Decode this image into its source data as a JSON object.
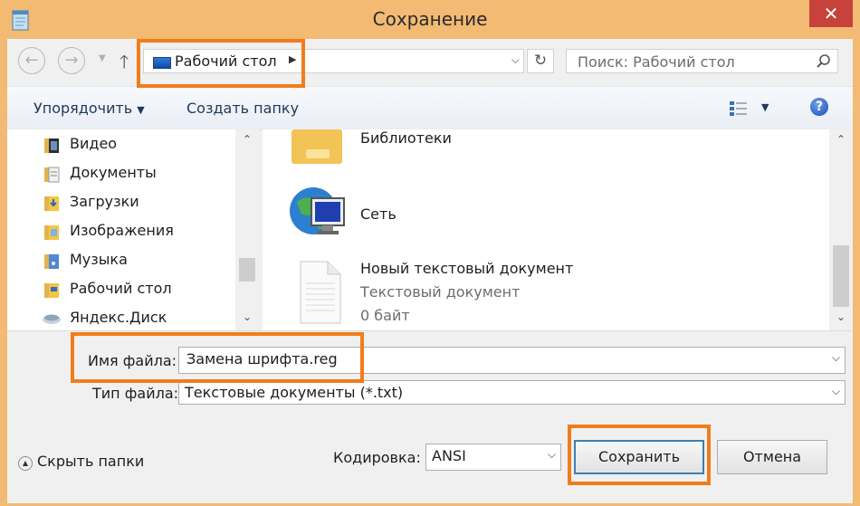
{
  "window": {
    "title": "Сохранение",
    "close_label": "✕",
    "accent_frame_color": "#f3ba73",
    "highlight_color": "#f27c1b"
  },
  "navbar": {
    "back_icon": "back-arrow-icon",
    "forward_icon": "forward-arrow-icon",
    "address_path": "Рабочий стол",
    "search_placeholder": "Поиск: Рабочий стол"
  },
  "toolbar": {
    "organize_label": "Упорядочить",
    "new_folder_label": "Создать папку",
    "help_label": "?"
  },
  "sidebar": {
    "items": [
      {
        "label": "Видео",
        "icon": "video-folder-icon"
      },
      {
        "label": "Документы",
        "icon": "documents-folder-icon"
      },
      {
        "label": "Загрузки",
        "icon": "downloads-folder-icon"
      },
      {
        "label": "Изображения",
        "icon": "pictures-folder-icon"
      },
      {
        "label": "Музыка",
        "icon": "music-folder-icon"
      },
      {
        "label": "Рабочий стол",
        "icon": "desktop-folder-icon"
      },
      {
        "label": "Яндекс.Диск",
        "icon": "yandex-disk-icon"
      }
    ]
  },
  "files": {
    "items": [
      {
        "name": "Библиотеки",
        "icon": "libraries-icon"
      },
      {
        "name": "Сеть",
        "icon": "network-icon"
      },
      {
        "name": "Новый текстовый документ",
        "type": "Текстовый документ",
        "size": "0 байт",
        "icon": "text-document-icon"
      }
    ]
  },
  "form": {
    "filename_label": "Имя файла:",
    "filename_value": "Замена шрифта.reg",
    "filetype_label": "Тип файла:",
    "filetype_value": "Текстовые документы (*.txt)",
    "encoding_label": "Кодировка:",
    "encoding_value": "ANSI",
    "hide_folders_label": "Скрыть папки",
    "save_label": "Сохранить",
    "cancel_label": "Отмена"
  }
}
